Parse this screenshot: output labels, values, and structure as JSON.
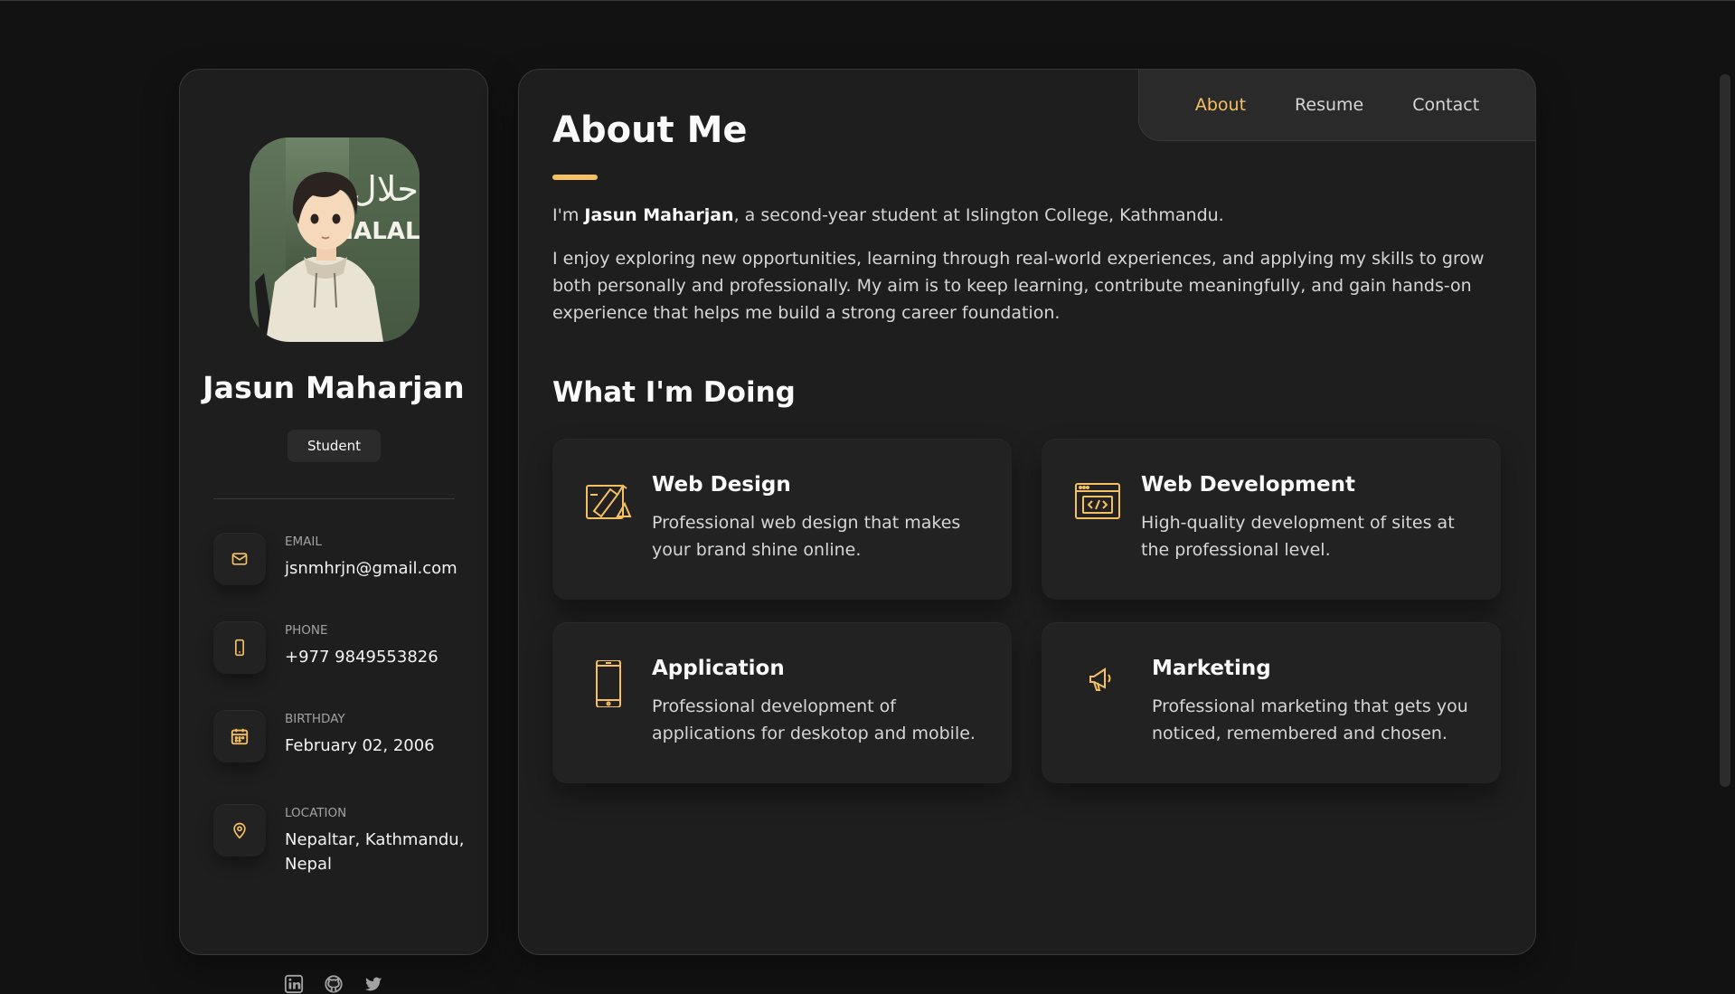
{
  "profile": {
    "name": "Jasun Maharjan",
    "title": "Student",
    "avatar_text": "HALAL",
    "avatar_arabic": "حلال"
  },
  "contacts": [
    {
      "icon": "mail-icon",
      "label": "Email",
      "value": "jsnmhrjn@gmail.com"
    },
    {
      "icon": "phone-icon",
      "label": "Phone",
      "value": "+977 9849553826"
    },
    {
      "icon": "calendar-icon",
      "label": "Birthday",
      "value": "February 02, 2006"
    },
    {
      "icon": "location-icon",
      "label": "Location",
      "value": "Nepaltar, Kathmandu, Nepal"
    }
  ],
  "socials": [
    "linkedin-icon",
    "github-icon",
    "twitter-icon"
  ],
  "nav": {
    "about": "About",
    "resume": "Resume",
    "contact": "Contact"
  },
  "about": {
    "heading": "About Me",
    "intro_prefix": "I'm ",
    "intro_name": "Jasun Maharjan",
    "intro_suffix": ", a second-year student at Islington College, Kathmandu.",
    "paragraph": "I enjoy exploring new opportunities, learning through real-world experiences, and applying my skills to grow both personally and professionally. My aim is to keep learning, contribute meaningfully, and gain hands-on experience that helps me build a strong career foundation."
  },
  "services": {
    "heading": "What I'm Doing",
    "items": [
      {
        "icon": "design-icon",
        "title": "Web Design",
        "text": "Professional web design that makes your brand shine online."
      },
      {
        "icon": "code-icon",
        "title": "Web Development",
        "text": "High-quality development of sites at the professional level."
      },
      {
        "icon": "mobile-icon",
        "title": "Application",
        "text": "Professional development of applications for deskotop and mobile."
      },
      {
        "icon": "megaphone-icon",
        "title": "Marketing",
        "text": "Professional marketing that gets you noticed, remembered and chosen."
      }
    ]
  },
  "colors": {
    "accent": "#f5c062",
    "background": "#121212",
    "card": "#1e1e1f"
  }
}
